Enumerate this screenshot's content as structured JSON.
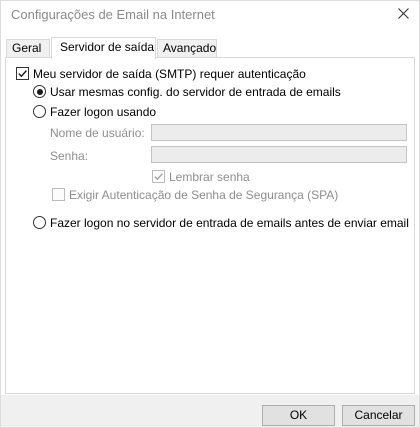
{
  "window": {
    "title": "Configurações de Email na Internet"
  },
  "tabs": [
    {
      "label": "Geral"
    },
    {
      "label": "Servidor de saída"
    },
    {
      "label": "Avançado"
    }
  ],
  "active_tab": "Servidor de saída",
  "panel": {
    "smtp_auth_checkbox": {
      "label": "Meu servidor de saída (SMTP) requer autenticação",
      "checked": true
    },
    "radio_same_settings": {
      "label": "Usar mesmas config. do servidor de entrada de emails",
      "selected": true
    },
    "radio_logon_using": {
      "label": "Fazer logon usando",
      "selected": false
    },
    "username": {
      "label": "Nome de usuário:",
      "value": ""
    },
    "password": {
      "label": "Senha:",
      "value": ""
    },
    "remember_password": {
      "label": "Lembrar senha",
      "checked": true,
      "enabled": false
    },
    "spa_checkbox": {
      "label": "Exigir Autenticação de Senha de Segurança (SPA)",
      "checked": false,
      "enabled": false
    },
    "radio_logon_incoming_first": {
      "label": "Fazer logon no servidor de entrada de emails antes de enviar email",
      "selected": false
    }
  },
  "buttons": {
    "ok": "OK",
    "cancel": "Cancelar"
  },
  "colors": {
    "disabled_text": "#8e8e8e",
    "footer_bg": "#f0f0f0",
    "button_bg": "#e1e1e1"
  }
}
